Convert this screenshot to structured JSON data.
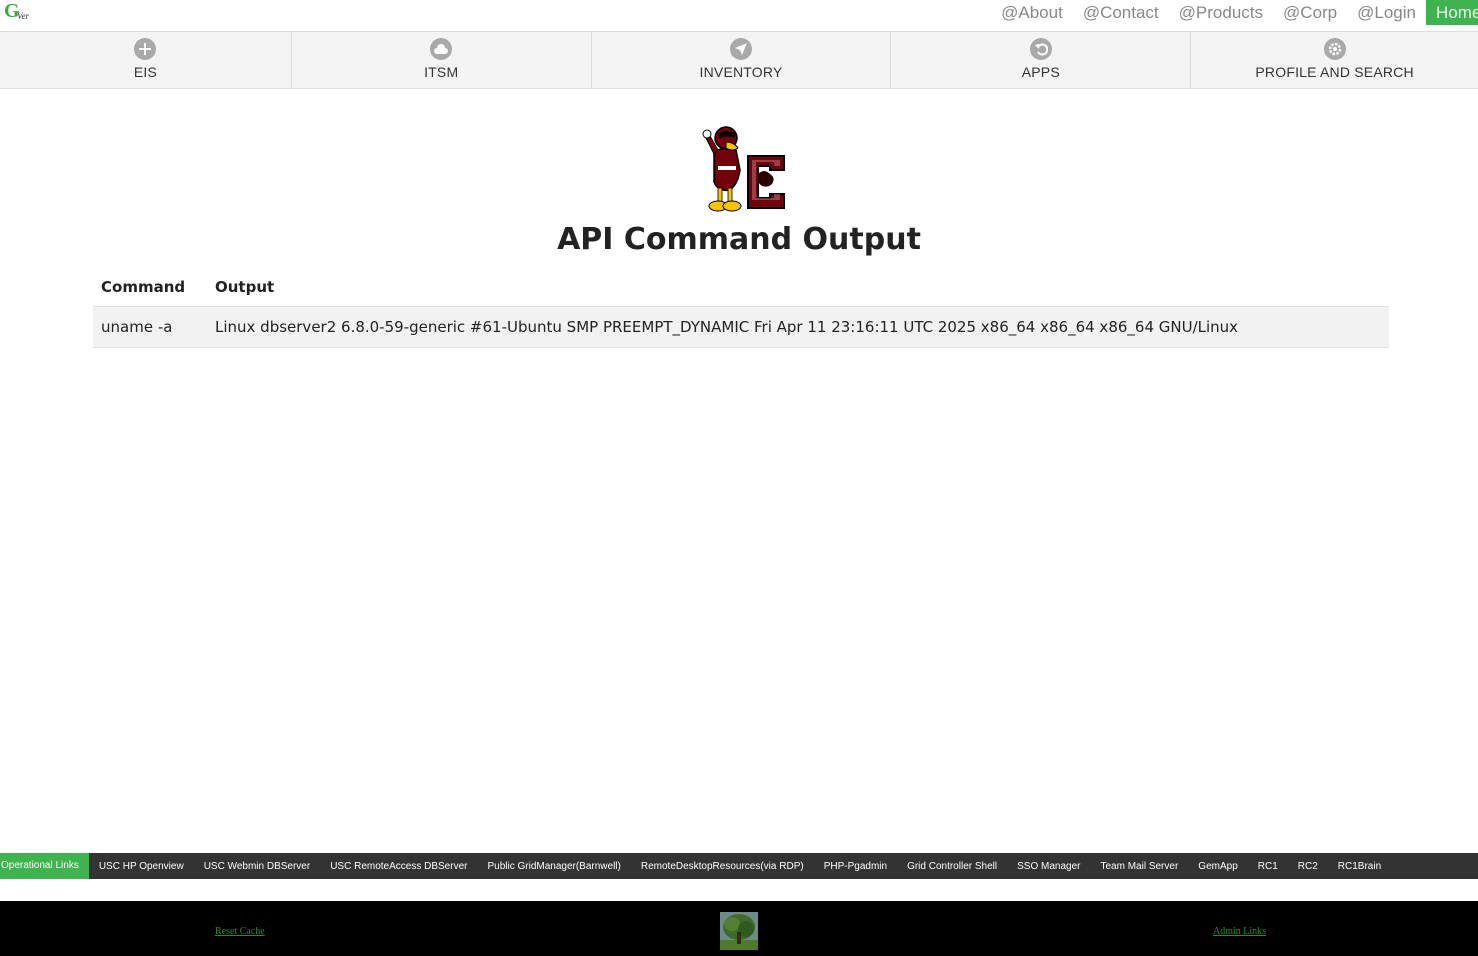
{
  "brand": {
    "logo_letter": "G",
    "logo_sub": "Ver"
  },
  "top_links": [
    {
      "label": "@About"
    },
    {
      "label": "@Contact"
    },
    {
      "label": "@Products"
    },
    {
      "label": "@Corp"
    },
    {
      "label": "@Login"
    }
  ],
  "home_label": "Home",
  "nav": [
    {
      "label": "EIS",
      "icon": "plus-circle-icon"
    },
    {
      "label": "ITSM",
      "icon": "cloud-icon"
    },
    {
      "label": "INVENTORY",
      "icon": "navigation-arrow-icon"
    },
    {
      "label": "APPS",
      "icon": "undo-icon"
    },
    {
      "label": "PROFILE AND SEARCH",
      "icon": "gear-icon"
    }
  ],
  "main": {
    "title": "API Command Output",
    "table": {
      "headers": [
        "Command",
        "Output"
      ],
      "rows": [
        {
          "command": "uname -a",
          "output": "Linux dbserver2 6.8.0-59-generic #61-Ubuntu SMP PREEMPT_DYNAMIC Fri Apr 11 23:16:11 UTC 2025 x86_64 x86_64 x86_64 GNU/Linux"
        }
      ]
    }
  },
  "operational": {
    "label": "Operational Links",
    "links": [
      "USC HP Openview",
      "USC Webmin DBServer",
      "USC RemoteAccess DBServer",
      "Public GridManager(Barnwell)",
      "RemoteDesktopResources(via RDP)",
      "PHP-Pgadmin",
      "Grid Controller Shell",
      "SSO Manager",
      "Team Mail Server",
      "GemApp",
      "RC1",
      "RC2",
      "RC1Brain"
    ]
  },
  "footer": {
    "reset": "Reset Cache",
    "admin": "Admin Links"
  },
  "colors": {
    "accent": "#3fb34f",
    "link_bar": "#333333",
    "footer": "#000000",
    "mascot_garnet": "#73000a"
  }
}
